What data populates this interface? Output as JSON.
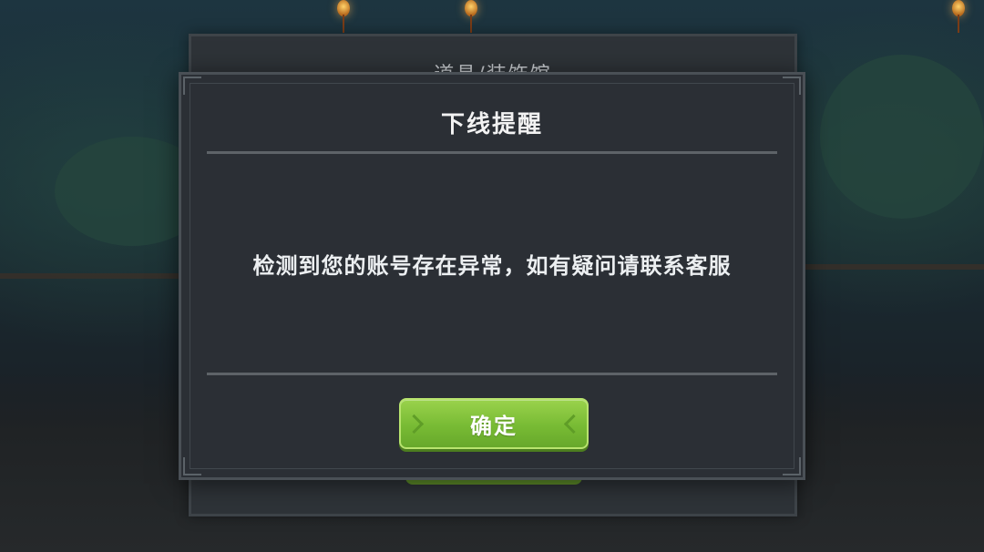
{
  "background": {
    "back_panel_title": "道具/装饰馆"
  },
  "dialog": {
    "title": "下线提醒",
    "message": "检测到您的账号存在异常，如有疑问请联系客服",
    "confirm_label": "确定"
  },
  "icons": {
    "confirm_left": "chevron-right-icon",
    "confirm_right": "chevron-left-icon"
  },
  "colors": {
    "dialog_bg": "#2b2f35",
    "confirm_green": "#78bb34"
  }
}
